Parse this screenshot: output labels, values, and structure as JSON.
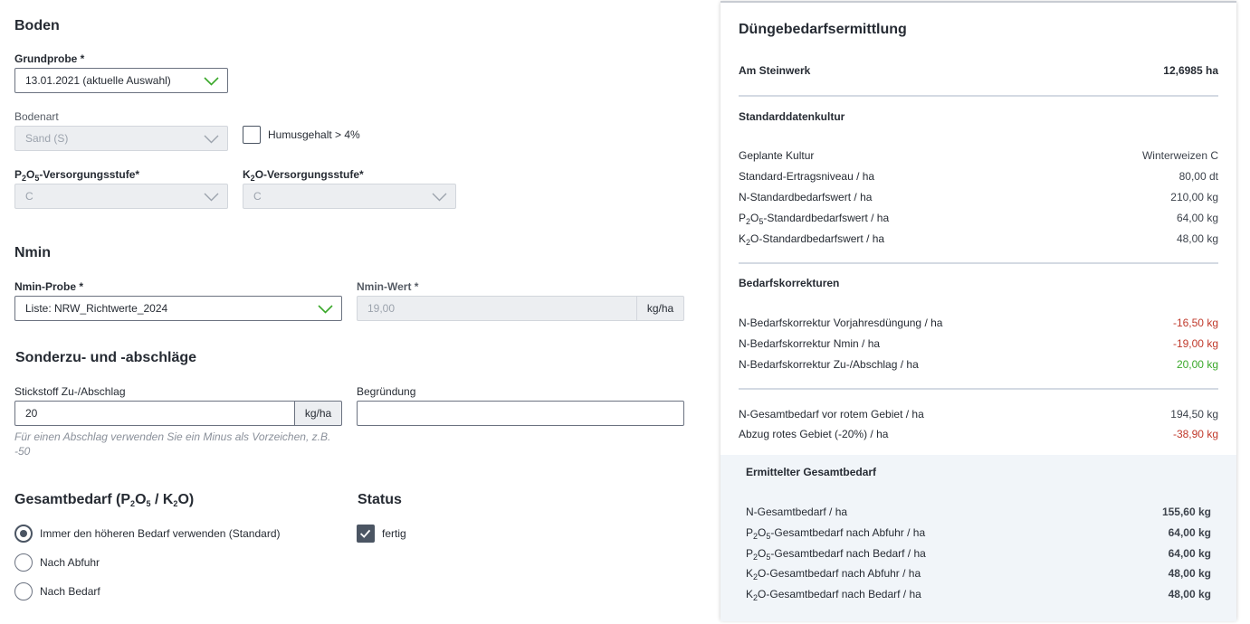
{
  "boden": {
    "title": "Boden",
    "grundprobe_label": "Grundprobe *",
    "grundprobe_value": "13.01.2021 (aktuelle Auswahl)",
    "bodenart_label": "Bodenart",
    "bodenart_value": "Sand (S)",
    "humus_label": "Humusgehalt > 4%",
    "humus_checked": false,
    "p2o5_label_pre": "P",
    "p2o5_label_s1": "2",
    "p2o5_label_mid": "O",
    "p2o5_label_s2": "5",
    "p2o5_label_post": "-Versorgungsstufe*",
    "p2o5_value": "C",
    "k2o_label_pre": "K",
    "k2o_label_s1": "2",
    "k2o_label_post": "O-Versorgungsstufe*",
    "k2o_value": "C"
  },
  "nmin": {
    "title": "Nmin",
    "probe_label": "Nmin-Probe *",
    "probe_value": "Liste: NRW_Richtwerte_2024",
    "wert_label": "Nmin-Wert *",
    "wert_value": "19,00",
    "wert_unit": "kg/ha"
  },
  "sonder": {
    "title": "Sonderzu- und -abschläge",
    "stick_label": "Stickstoff Zu-/Abschlag",
    "stick_value": "20",
    "stick_unit": "kg/ha",
    "hint_line1": "Für einen Abschlag verwenden Sie ein Minus als Vorzeichen, z.B.",
    "hint_line2": "-50",
    "begruendung_label": "Begründung",
    "begruendung_value": ""
  },
  "gesamt": {
    "title_pre": "Gesamtbedarf (P",
    "title_s1": "2",
    "title_mid": "O",
    "title_s2": "5",
    "title_mid2": " / K",
    "title_s3": "2",
    "title_post": "O)",
    "options": [
      {
        "label": "Immer den höheren Bedarf verwenden (Standard)",
        "selected": true
      },
      {
        "label": "Nach Abfuhr",
        "selected": false
      },
      {
        "label": "Nach Bedarf",
        "selected": false
      }
    ]
  },
  "status": {
    "title": "Status",
    "label": "fertig",
    "checked": true
  },
  "panel": {
    "title": "Düngebedarfsermittlung",
    "field_name": "Am Steinwerk",
    "field_area": "12,6985 ha",
    "standard_title": "Standarddatenkultur",
    "standard_rows": [
      {
        "k": "Geplante Kultur",
        "v": "Winterweizen C"
      },
      {
        "k": "Standard-Ertragsniveau / ha",
        "v": "80,00 dt"
      },
      {
        "k": "N-Standardbedarfswert / ha",
        "v": "210,00 kg"
      },
      {
        "k_pre": "P",
        "k_s1": "2",
        "k_mid": "O",
        "k_s2": "5",
        "k_post": "-Standardbedarfswert / ha",
        "v": "64,00 kg"
      },
      {
        "k_pre": "K",
        "k_s1": "2",
        "k_post": "O-Standardbedarfswert / ha",
        "v": "48,00 kg"
      }
    ],
    "korr_title": "Bedarfskorrekturen",
    "korr_rows": [
      {
        "k": "N-Bedarfskorrektur Vorjahresdüngung / ha",
        "v": "-16,50 kg",
        "tone": "neg"
      },
      {
        "k": "N-Bedarfskorrektur Nmin / ha",
        "v": "-19,00 kg",
        "tone": "neg"
      },
      {
        "k": "N-Bedarfskorrektur Zu-/Abschlag / ha",
        "v": "20,00 kg",
        "tone": "pos"
      }
    ],
    "total_rows": [
      {
        "k": "N-Gesamtbedarf vor rotem Gebiet / ha",
        "v": "194,50 kg",
        "tone": ""
      },
      {
        "k": "Abzug rotes Gebiet (-20%) / ha",
        "v": "-38,90 kg",
        "tone": "neg"
      }
    ],
    "summary_title": "Ermittelter Gesamtbedarf",
    "summary_rows": [
      {
        "k": "N-Gesamtbedarf / ha",
        "v": "155,60 kg"
      },
      {
        "k_pre": "P",
        "k_s1": "2",
        "k_mid": "O",
        "k_s2": "5",
        "k_post": "-Gesamtbedarf nach Abfuhr / ha",
        "v": "64,00 kg"
      },
      {
        "k_pre": "P",
        "k_s1": "2",
        "k_mid": "O",
        "k_s2": "5",
        "k_post": "-Gesamtbedarf nach Bedarf / ha",
        "v": "64,00 kg"
      },
      {
        "k_pre": "K",
        "k_s1": "2",
        "k_post": "O-Gesamtbedarf nach Abfuhr / ha",
        "v": "48,00 kg"
      },
      {
        "k_pre": "K",
        "k_s1": "2",
        "k_post": "O-Gesamtbedarf nach Bedarf / ha",
        "v": "48,00 kg"
      }
    ]
  },
  "colors": {
    "accent_check": "#3aa82a",
    "negative": "#c0392b",
    "positive": "#3aa82a",
    "control_dark": "#4b5563"
  },
  "icons": {
    "dropdown": "chevron-down-icon",
    "check": "check-icon"
  }
}
